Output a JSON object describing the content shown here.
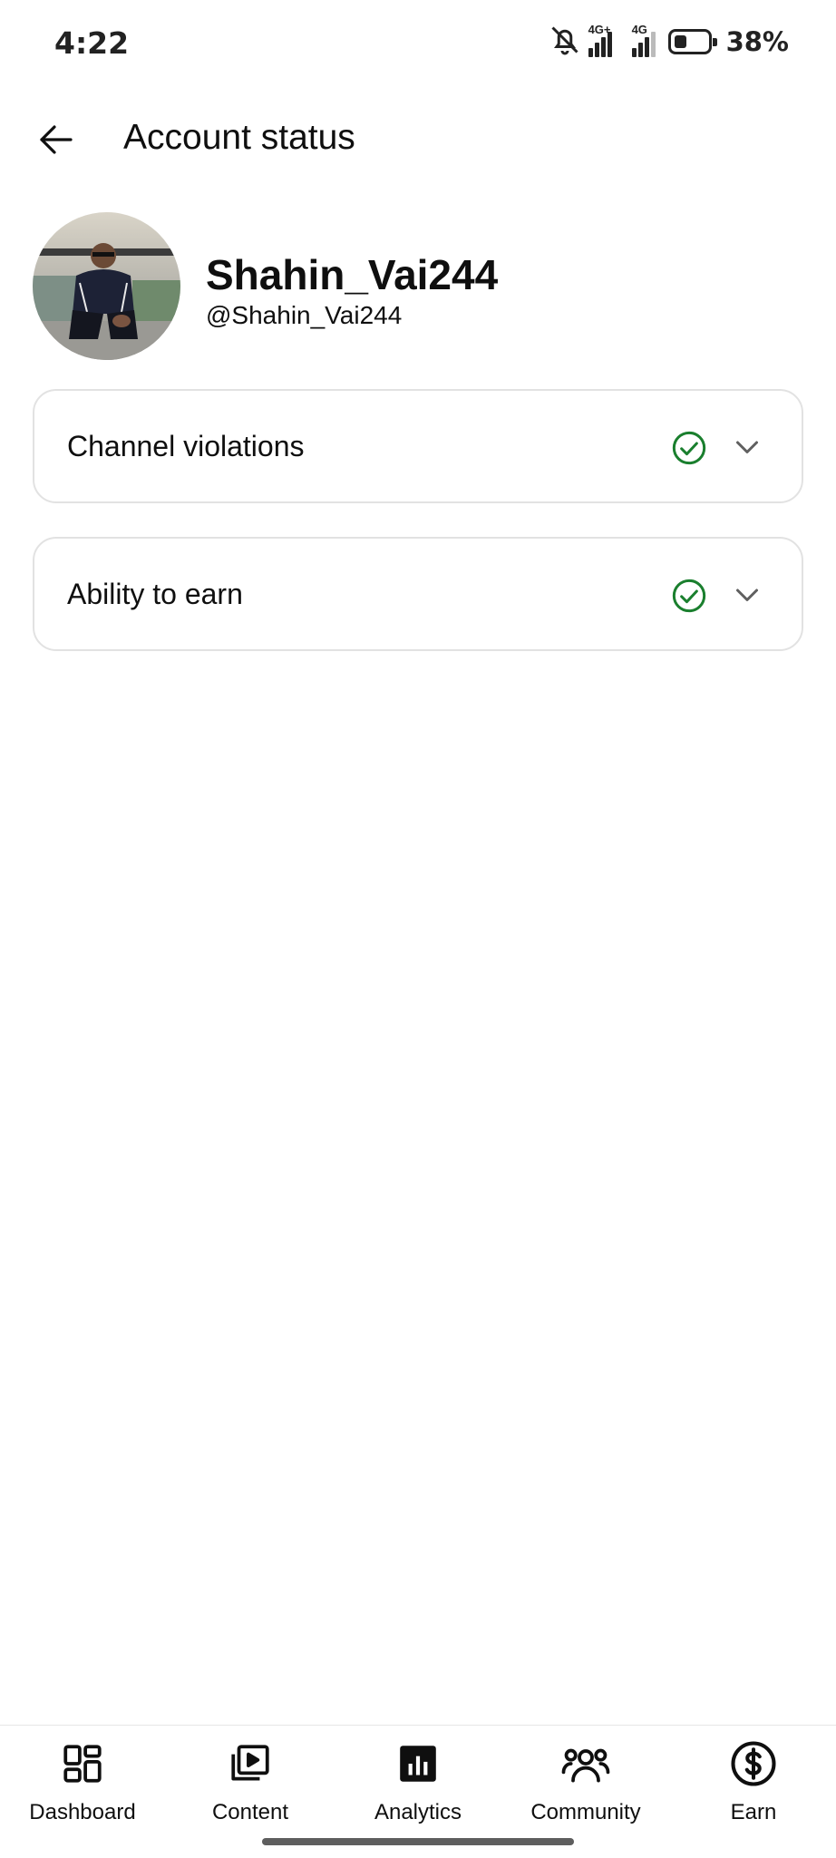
{
  "status_bar": {
    "time": "4:22",
    "signal_1_label": "4G+",
    "signal_2_label": "4G",
    "battery_percent": "38%",
    "battery_level": 0.38,
    "icons": [
      "bell-muted-icon",
      "signal-icon",
      "signal-icon",
      "battery-icon"
    ]
  },
  "header": {
    "back_icon": "arrow-left-icon",
    "title": "Account status"
  },
  "profile": {
    "name": "Shahin_Vai244",
    "handle": "@Shahin_Vai244"
  },
  "cards": [
    {
      "label": "Channel violations",
      "status_icon": "check-circle-icon",
      "expand_icon": "chevron-down-icon"
    },
    {
      "label": "Ability to earn",
      "status_icon": "check-circle-icon",
      "expand_icon": "chevron-down-icon"
    }
  ],
  "bottom_nav": {
    "items": [
      {
        "label": "Dashboard",
        "icon": "dashboard-icon"
      },
      {
        "label": "Content",
        "icon": "content-icon"
      },
      {
        "label": "Analytics",
        "icon": "analytics-icon"
      },
      {
        "label": "Community",
        "icon": "community-icon"
      },
      {
        "label": "Earn",
        "icon": "earn-icon"
      }
    ]
  },
  "colors": {
    "status_ok": "#1a7f2e",
    "text_primary": "#0f0f0f",
    "card_border": "#e2e2e2",
    "chevron": "#606060"
  }
}
